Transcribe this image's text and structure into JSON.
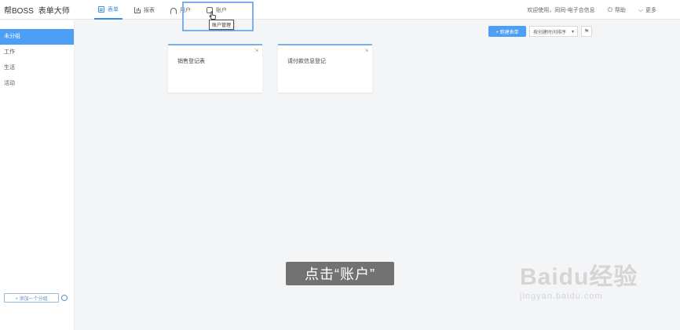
{
  "brand": {
    "logo": "帮BOSS",
    "product": "表单大师"
  },
  "nav": [
    {
      "label": "表单",
      "icon": "form-icon",
      "active": true
    },
    {
      "label": "报表",
      "icon": "bar-chart-icon",
      "active": false
    },
    {
      "label": "用户",
      "icon": "users-icon",
      "active": false
    },
    {
      "label": "账户",
      "icon": "account-icon",
      "active": false
    }
  ],
  "tooltip": "账户管理",
  "header_right": {
    "welcome": "欢迎使用，同同-电子合信息",
    "help": "帮助",
    "more": "更多"
  },
  "sidebar": {
    "items": [
      {
        "label": "未分组",
        "active": true
      },
      {
        "label": "工作",
        "active": false
      },
      {
        "label": "生活",
        "active": false
      },
      {
        "label": "活动",
        "active": false
      }
    ],
    "add_group": "+ 添加一个分组"
  },
  "toolbar": {
    "new_button": "+ 新建表单",
    "sort_select": "按创建时间排序",
    "flag_icon": "flag-icon"
  },
  "cards": [
    {
      "title": "销售登记表"
    },
    {
      "title": "请付款信息登记"
    }
  ],
  "caption": "点击“账户”",
  "watermark": {
    "text": "Baidu经验",
    "url": "jingyan.baidu.com"
  },
  "colors": {
    "accent": "#4d9ef5",
    "highlight": "#7cb0e8"
  }
}
